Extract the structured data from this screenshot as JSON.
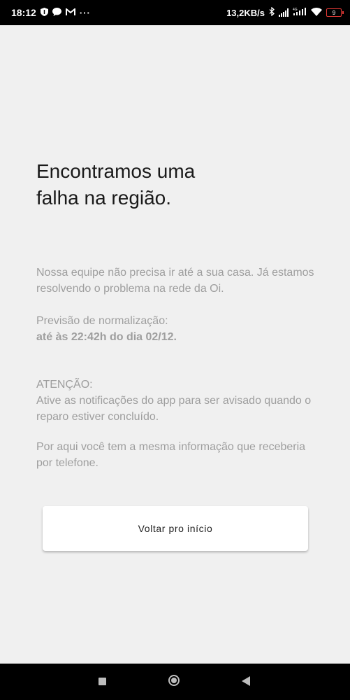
{
  "status_bar": {
    "time": "18:12",
    "more_dots": "···",
    "network_speed": "13,2KB/s",
    "battery_level": "9",
    "network_type": "4G"
  },
  "main": {
    "title": "Encontramos uma falha na região.",
    "paragraph1": "Nossa equipe não precisa ir até a sua casa. Já estamos resolvendo o problema na rede da Oi.",
    "forecast_label": "Previsão de normalização:",
    "forecast_value": "até às 22:42h do dia 02/12.",
    "attention_label": "ATENÇÃO:",
    "attention_text": "Ative as notificações do app para ser avisado quando o reparo estiver concluído.",
    "info_text": "Por aqui você tem a mesma informação que receberia por telefone."
  },
  "button": {
    "label": "Voltar pro início"
  },
  "colors": {
    "background": "#f0f0f0",
    "title": "#1a1a1a",
    "body_text": "#9e9e9e",
    "button_bg": "#ffffff",
    "battery_low": "#e53935"
  }
}
